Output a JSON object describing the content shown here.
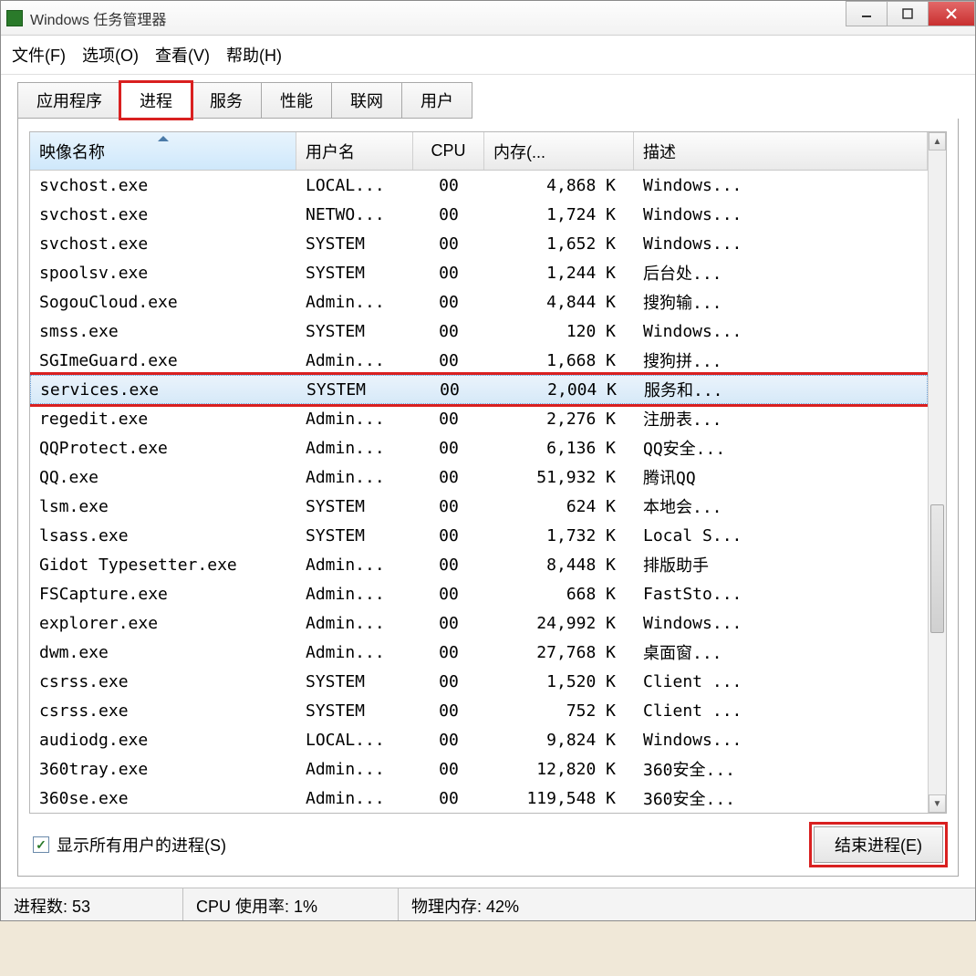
{
  "window": {
    "title": "Windows 任务管理器"
  },
  "menu": {
    "file": "文件(F)",
    "options": "选项(O)",
    "view": "查看(V)",
    "help": "帮助(H)"
  },
  "tabs": {
    "applications": "应用程序",
    "processes": "进程",
    "services": "服务",
    "performance": "性能",
    "networking": "联网",
    "users": "用户"
  },
  "columns": {
    "image_name": "映像名称",
    "user_name": "用户名",
    "cpu": "CPU",
    "memory": "内存(...",
    "description": "描述"
  },
  "processes": [
    {
      "name": "svchost.exe",
      "user": "LOCAL...",
      "cpu": "00",
      "mem": "4,868 K",
      "desc": "Windows..."
    },
    {
      "name": "svchost.exe",
      "user": "NETWO...",
      "cpu": "00",
      "mem": "1,724 K",
      "desc": "Windows..."
    },
    {
      "name": "svchost.exe",
      "user": "SYSTEM",
      "cpu": "00",
      "mem": "1,652 K",
      "desc": "Windows..."
    },
    {
      "name": "spoolsv.exe",
      "user": "SYSTEM",
      "cpu": "00",
      "mem": "1,244 K",
      "desc": "后台处..."
    },
    {
      "name": "SogouCloud.exe",
      "user": "Admin...",
      "cpu": "00",
      "mem": "4,844 K",
      "desc": "搜狗输..."
    },
    {
      "name": "smss.exe",
      "user": "SYSTEM",
      "cpu": "00",
      "mem": "120 K",
      "desc": "Windows..."
    },
    {
      "name": "SGImeGuard.exe",
      "user": "Admin...",
      "cpu": "00",
      "mem": "1,668 K",
      "desc": "搜狗拼..."
    },
    {
      "name": "services.exe",
      "user": "SYSTEM",
      "cpu": "00",
      "mem": "2,004 K",
      "desc": "服务和...",
      "selected": true
    },
    {
      "name": "regedit.exe",
      "user": "Admin...",
      "cpu": "00",
      "mem": "2,276 K",
      "desc": "注册表..."
    },
    {
      "name": "QQProtect.exe",
      "user": "Admin...",
      "cpu": "00",
      "mem": "6,136 K",
      "desc": "QQ安全..."
    },
    {
      "name": "QQ.exe",
      "user": "Admin...",
      "cpu": "00",
      "mem": "51,932 K",
      "desc": "腾讯QQ"
    },
    {
      "name": "lsm.exe",
      "user": "SYSTEM",
      "cpu": "00",
      "mem": "624 K",
      "desc": "本地会..."
    },
    {
      "name": "lsass.exe",
      "user": "SYSTEM",
      "cpu": "00",
      "mem": "1,732 K",
      "desc": "Local S..."
    },
    {
      "name": "Gidot Typesetter.exe",
      "user": "Admin...",
      "cpu": "00",
      "mem": "8,448 K",
      "desc": "排版助手"
    },
    {
      "name": "FSCapture.exe",
      "user": "Admin...",
      "cpu": "00",
      "mem": "668 K",
      "desc": "FastSto..."
    },
    {
      "name": "explorer.exe",
      "user": "Admin...",
      "cpu": "00",
      "mem": "24,992 K",
      "desc": "Windows..."
    },
    {
      "name": "dwm.exe",
      "user": "Admin...",
      "cpu": "00",
      "mem": "27,768 K",
      "desc": "桌面窗..."
    },
    {
      "name": "csrss.exe",
      "user": "SYSTEM",
      "cpu": "00",
      "mem": "1,520 K",
      "desc": "Client ..."
    },
    {
      "name": "csrss.exe",
      "user": "SYSTEM",
      "cpu": "00",
      "mem": "752 K",
      "desc": "Client ..."
    },
    {
      "name": "audiodg.exe",
      "user": "LOCAL...",
      "cpu": "00",
      "mem": "9,824 K",
      "desc": "Windows..."
    },
    {
      "name": "360tray.exe",
      "user": "Admin...",
      "cpu": "00",
      "mem": "12,820 K",
      "desc": "360安全..."
    },
    {
      "name": "360se.exe",
      "user": "Admin...",
      "cpu": "00",
      "mem": "119,548 K",
      "desc": "360安全..."
    }
  ],
  "footer": {
    "show_all_users": "显示所有用户的进程(S)",
    "end_process": "结束进程(E)"
  },
  "status": {
    "process_count_label": "进程数:",
    "process_count": "53",
    "cpu_label": "CPU 使用率:",
    "cpu_value": "1%",
    "mem_label": "物理内存:",
    "mem_value": "42%"
  }
}
